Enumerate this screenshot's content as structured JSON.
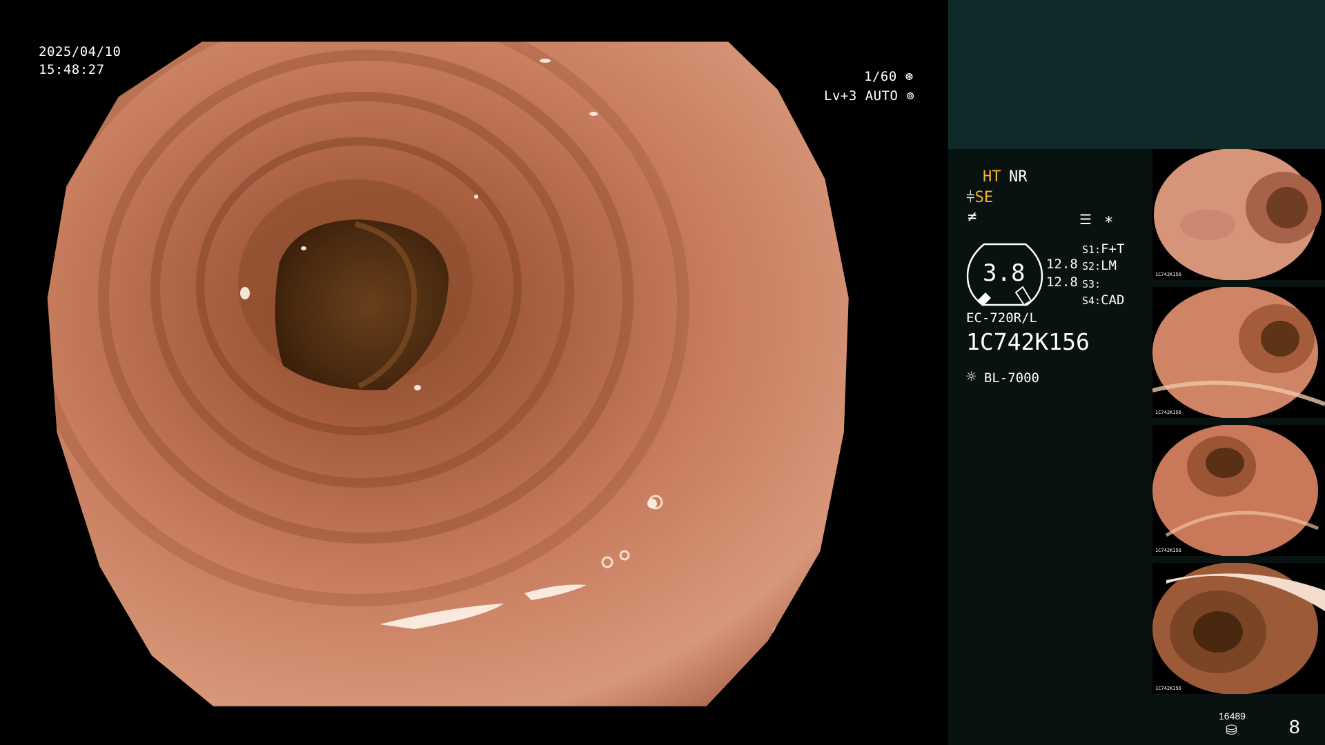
{
  "overlay": {
    "date": "2025/04/10",
    "time": "15:48:27",
    "shutter": "1/60",
    "level": "Lv+3 AUTO"
  },
  "panel": {
    "ht": "HT",
    "nr": "NR",
    "se": "SE",
    "gauge_value": "3.8",
    "gauge_side_1": "12.8",
    "gauge_side_2": "12.8",
    "s1_label": "S1:",
    "s1_value": "F+T",
    "s2_label": "S2:",
    "s2_value": "LM",
    "s3_label": "S3:",
    "s3_value": "",
    "s4_label": "S4:",
    "s4_value": "CAD",
    "scope_model": "EC-720R/L",
    "serial": "1C742K156",
    "light_source": "BL-7000",
    "storage_count": "16489",
    "image_count": "8"
  },
  "thumbnail_text": "1C742K156",
  "colors": {
    "panel_bg": "#071211",
    "panel_top_bg": "#0f2a28",
    "accent_orange": "#f5b330",
    "mucosa": "#c97d5e",
    "lumen": "#5a3515"
  },
  "icons": [
    "shutter-icon",
    "auto-iris-icon",
    "enhance-icon",
    "freeze-icon",
    "memory-icon",
    "star-icon",
    "light-source-icon",
    "storage-icon"
  ]
}
